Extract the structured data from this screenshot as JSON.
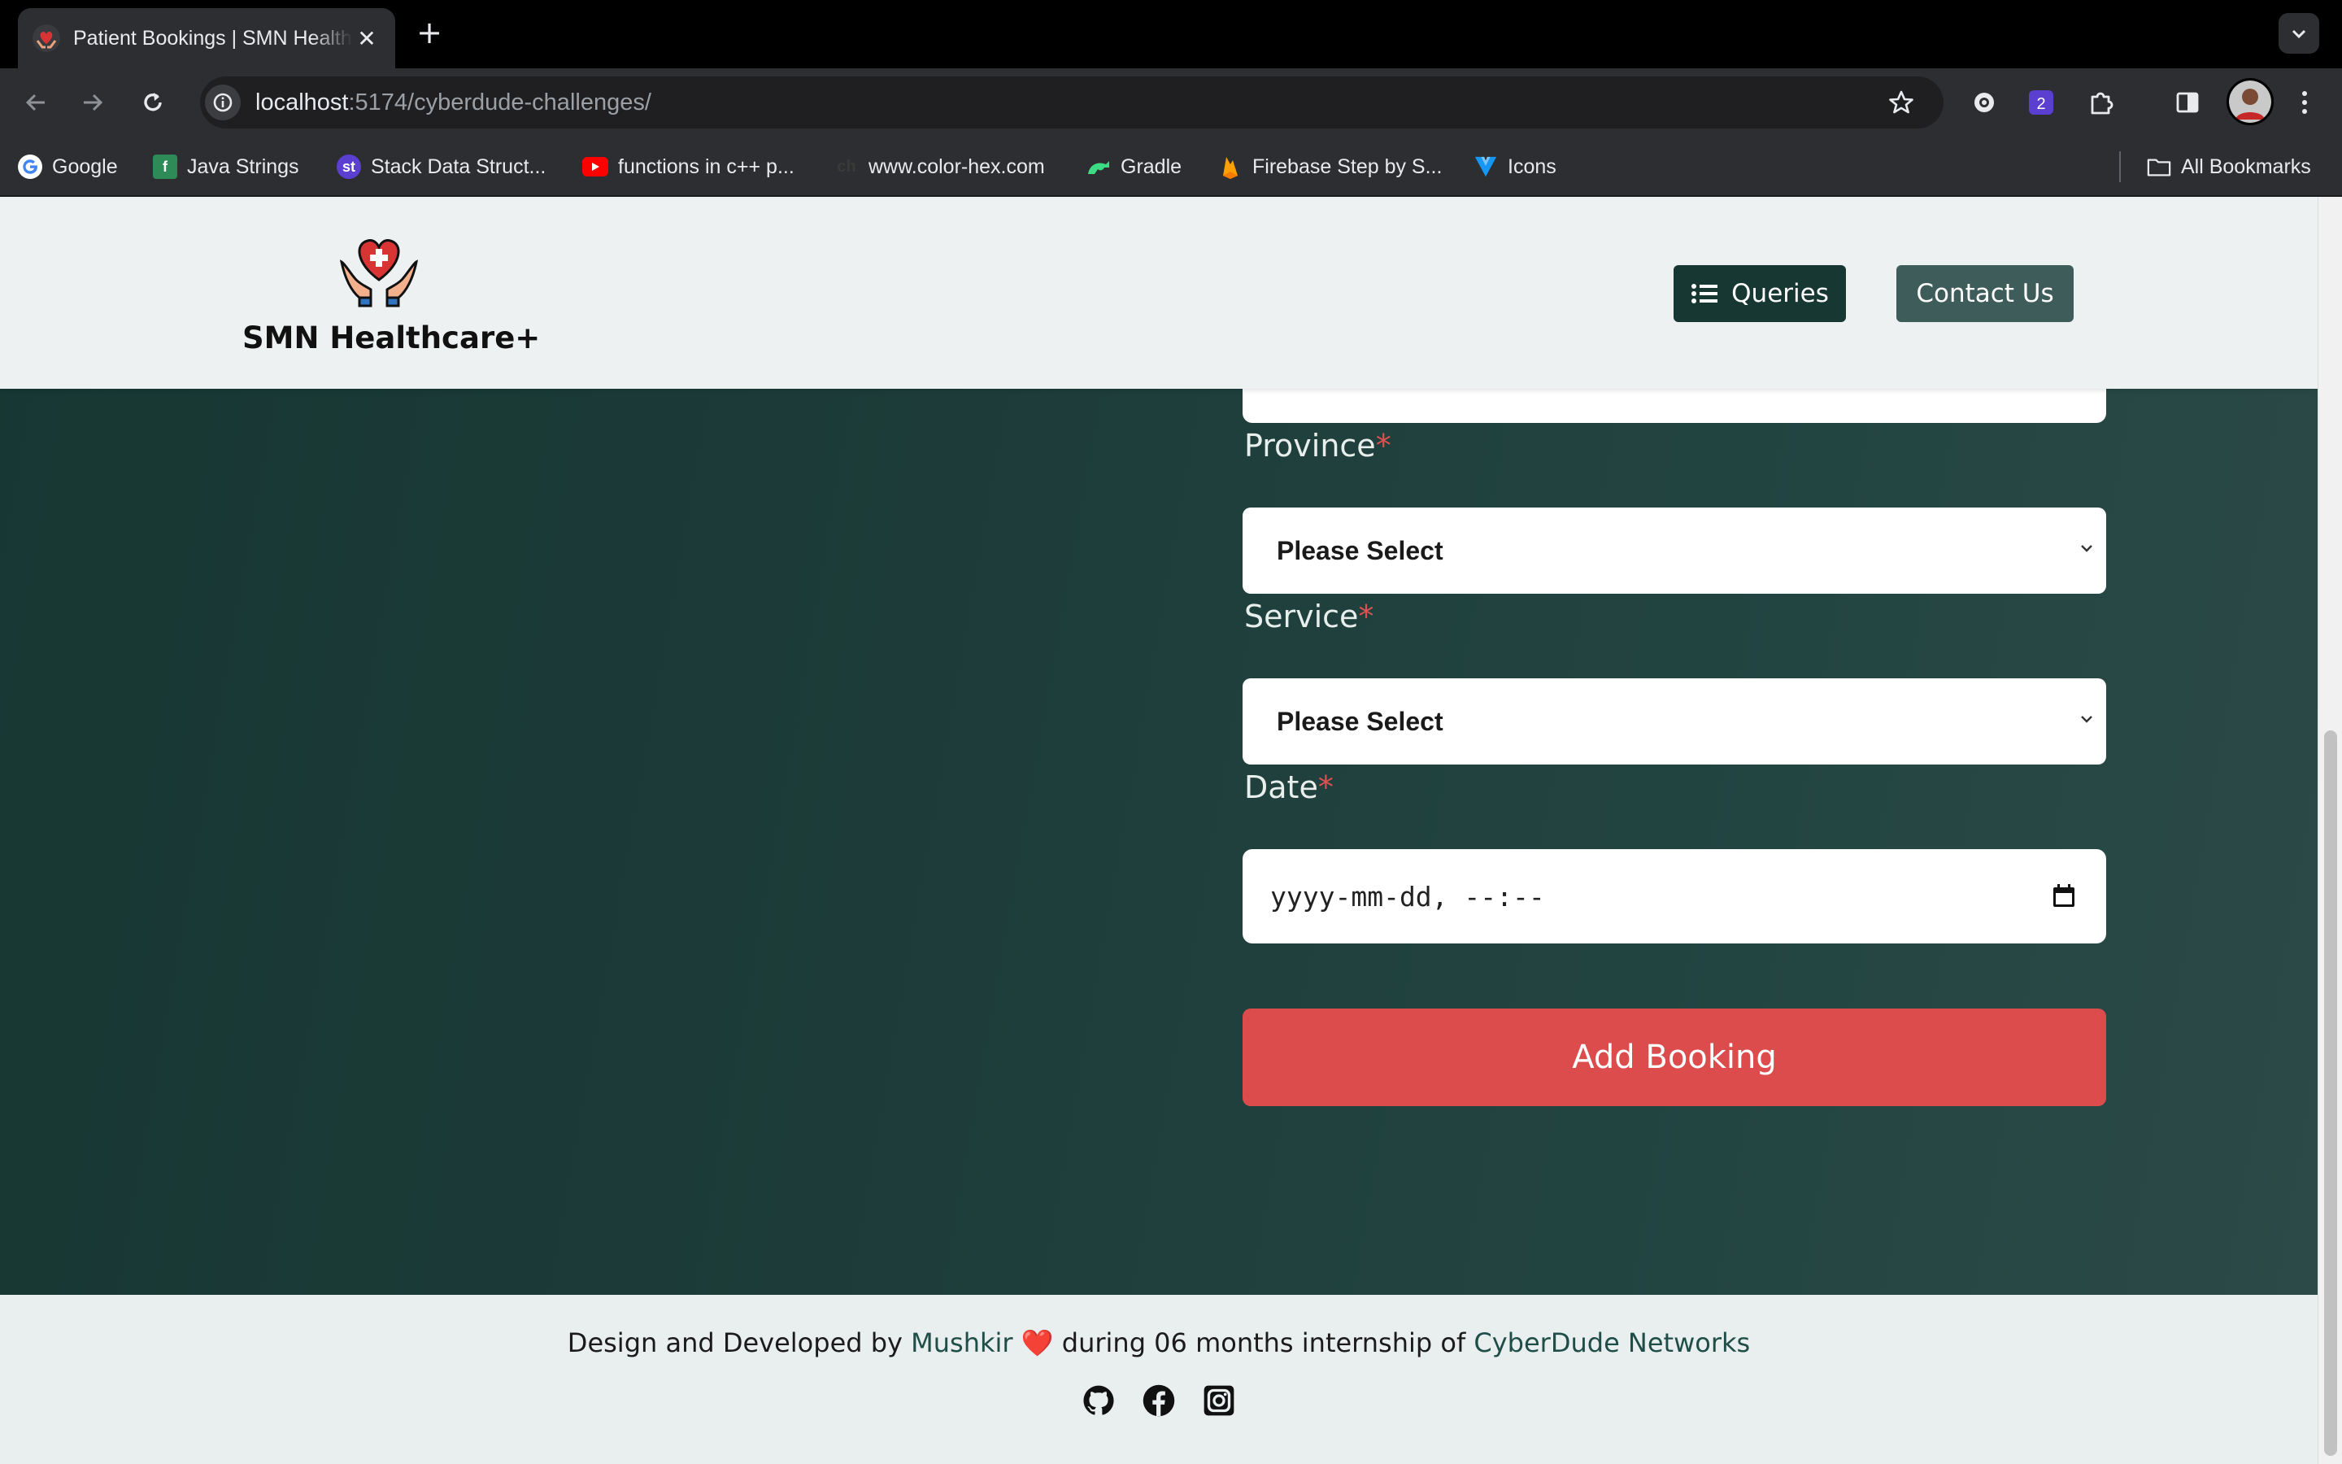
{
  "browser": {
    "tab": {
      "title": "Patient Bookings | SMN Healthcare+",
      "close_symbol": "✕",
      "favicon": "care-hands-icon"
    },
    "new_tab_symbol": "+",
    "url": {
      "host": "localhost",
      "path": ":5174/cyberdude-challenges/"
    },
    "bookmarks": [
      {
        "label": "Google",
        "icon": "google-icon"
      },
      {
        "label": "Java Strings",
        "icon": "java-strings-icon"
      },
      {
        "label": "Stack Data Struct...",
        "icon": "studytonight-icon"
      },
      {
        "label": "functions in c++ p...",
        "icon": "youtube-icon"
      },
      {
        "label": "www.color-hex.com",
        "icon": "color-hex-icon"
      },
      {
        "label": "Gradle",
        "icon": "gradle-icon"
      },
      {
        "label": "Firebase Step by S...",
        "icon": "firebase-icon"
      },
      {
        "label": "Icons",
        "icon": "vuetify-icon"
      }
    ],
    "all_bookmarks": "All Bookmarks"
  },
  "header": {
    "brand": "SMN Healthcare+",
    "queries_label": "Queries",
    "contact_label": "Contact Us"
  },
  "form": {
    "province": {
      "label": "Province",
      "required_mark": "*",
      "value": "Please Select"
    },
    "service": {
      "label": "Service",
      "required_mark": "*",
      "value": "Please Select"
    },
    "date": {
      "label": "Date",
      "required_mark": "*",
      "value": "yyyy-mm-dd, --:--"
    },
    "submit_label": "Add Booking"
  },
  "footer": {
    "credit_prefix": "Design and Developed by",
    "author": "Mushkir",
    "heart": "❤️",
    "credit_middle": "during 06 months internship of",
    "company": "CyberDude Networks",
    "socials": [
      "github-icon",
      "facebook-icon",
      "instagram-icon"
    ]
  },
  "colors": {
    "hero_dark": "#173733",
    "accent_red": "#dc4c4c",
    "header_bg": "#eef1f1",
    "queries_btn": "#173733",
    "contact_btn": "#3d5c5a"
  }
}
